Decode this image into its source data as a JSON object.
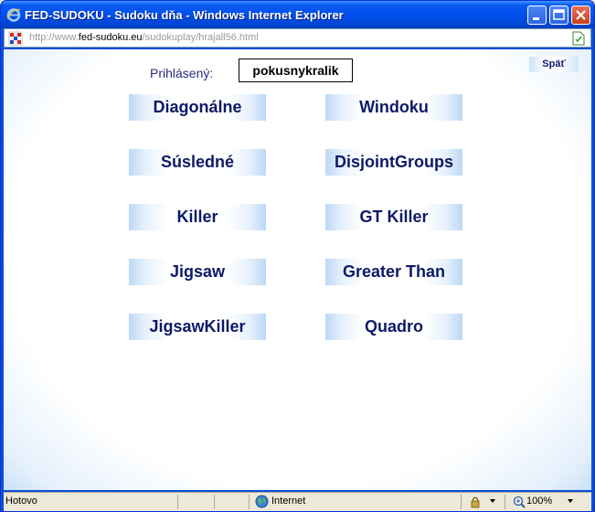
{
  "window": {
    "title": "FED-SUDOKU - Sudoku dňa - Windows Internet Explorer",
    "controls": {
      "minimize": "minimize-icon",
      "maximize": "maximize-icon",
      "close": "close-icon"
    }
  },
  "address": {
    "prefix": "http://www.",
    "domain": "fed-sudoku.eu",
    "path": "/sudokuplay/hrajall56.html"
  },
  "page": {
    "back_label": "Späť",
    "login_label": "Prihlásený:",
    "login_user": "pokusnykralik",
    "variants": [
      {
        "label": "Diagonálne"
      },
      {
        "label": "Windoku"
      },
      {
        "label": "Súsledné"
      },
      {
        "label": "DisjointGroups"
      },
      {
        "label": "Killer"
      },
      {
        "label": "GT Killer"
      },
      {
        "label": "Jigsaw"
      },
      {
        "label": "Greater Than"
      },
      {
        "label": "JigsawKiller"
      },
      {
        "label": "Quadro"
      }
    ]
  },
  "status": {
    "text": "Hotovo",
    "zone": "Internet",
    "zoom": "100%"
  },
  "colors": {
    "title_bar": "#0050ee",
    "button_text": "#0d1a66",
    "button_edge": "#bcd8f5"
  }
}
